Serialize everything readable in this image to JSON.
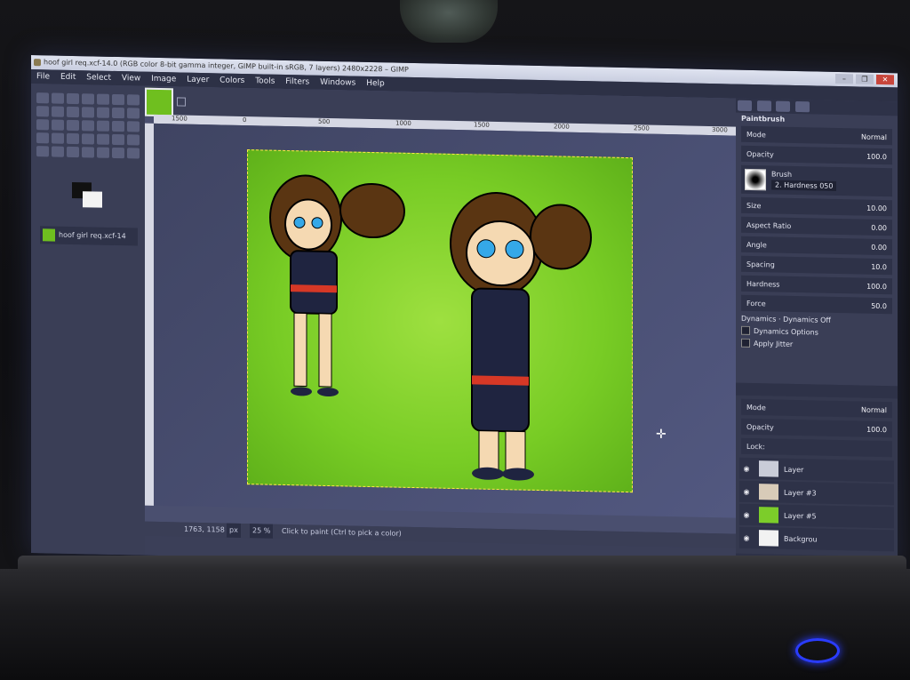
{
  "window": {
    "title": "hoof girl req.xcf-14.0 (RGB color 8-bit gamma integer, GIMP built-in sRGB, 7 layers) 2480x2228 – GIMP",
    "buttons": [
      "–",
      "❐",
      "✕"
    ]
  },
  "menu": [
    "File",
    "Edit",
    "Select",
    "View",
    "Image",
    "Layer",
    "Colors",
    "Tools",
    "Filters",
    "Windows",
    "Help"
  ],
  "images_panel": {
    "item": "hoof girl req.xcf-14"
  },
  "ruler_labels": [
    "1500",
    "0",
    "500",
    "1000",
    "1500",
    "2000",
    "2500",
    "3000"
  ],
  "status": {
    "position": "1763, 1158",
    "unit": "px",
    "zoom": "25 %",
    "hint": "Click to paint (Ctrl to pick a color)"
  },
  "tool_options": {
    "title": "Paintbrush",
    "mode_label": "Mode",
    "mode_value": "Normal",
    "opacity_label": "Opacity",
    "opacity_value": "100.0",
    "brush_label": "Brush",
    "brush_name": "2. Hardness 050",
    "size_label": "Size",
    "size_value": "10.00",
    "aspect_label": "Aspect Ratio",
    "aspect_value": "0.00",
    "angle_label": "Angle",
    "angle_value": "0.00",
    "spacing_label": "Spacing",
    "spacing_value": "10.0",
    "hardness_label": "Hardness",
    "hardness_value": "100.0",
    "force_label": "Force",
    "force_value": "50.0",
    "dynamics_label": "Dynamics",
    "dynamics_value": "Dynamics Off",
    "dynamics_options": "Dynamics Options",
    "apply_jitter": "Apply Jitter"
  },
  "layers_panel": {
    "mode_label": "Mode",
    "mode_value": "Normal",
    "opacity_label": "Opacity",
    "opacity_value": "100.0",
    "lock_label": "Lock:",
    "layers": [
      {
        "name": "Layer",
        "color": "#c9ccd8"
      },
      {
        "name": "Layer #3",
        "color": "#d8cbb8"
      },
      {
        "name": "Layer #5",
        "color": "#7ccd2a"
      },
      {
        "name": "Backgrou",
        "color": "#f2f2f2"
      }
    ]
  },
  "colors": {
    "canvas_green": "#78cc25",
    "selection": "#ffe84a"
  }
}
